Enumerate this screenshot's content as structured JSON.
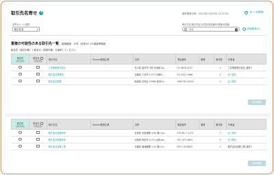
{
  "header": {
    "title": "取引先名寄せ",
    "help_icon": "help-icon",
    "updated": "最終更新日時：2021年11月30日 14:07:00",
    "update_link": "データ更新"
  },
  "filter": {
    "label": "名寄せルール選択",
    "value": "取引先名"
  },
  "search": {
    "label": "取引先名/取引先区分/住所/電話番号/業種/代表者",
    "placeholder": "検索",
    "detail_link": "詳細検索(5)"
  },
  "section": {
    "title": "重複の可能性のある取引先一覧",
    "count": "重複候補：12件（全体の0.2%重複率程度）",
    "note": "統合先（保存対象）と統合元（削除対象）を選択してください"
  },
  "table1": {
    "headers": {
      "merge_to": "統合先",
      "merge_to_sub": "(保存対象)",
      "merge_from": "統合元",
      "merge_from_sub": "(削除対象)",
      "name": "取引先名",
      "sansan": "Sansan登録企業",
      "address": "住所",
      "phone": "電話番号",
      "industry": "業種",
      "count": "案件数",
      "rep": "代表者"
    },
    "rows": [
      {
        "name": "三井物産株式会社",
        "sansan": "",
        "address": "石川県 金沢市 中町 石坂町Lw…",
        "phone": "03-3876-5272",
        "industry": "",
        "count": "1",
        "rep": "三井物産株式会社_案件1"
      },
      {
        "name": "株式会社電算商",
        "sansan": "",
        "address": "青森県 三沢市 3-277 大崎Lt…",
        "phone": "03-2337-1968",
        "industry": "",
        "count": "2",
        "rep": "全て表示"
      },
      {
        "name": "株式会社電算",
        "sansan": "",
        "address": "新潟県 中央区 25980 松本Lo…",
        "phone": "058178-3-6192",
        "industry": "",
        "count": "2",
        "rep": "全て表示"
      }
    ],
    "button": "統合確認"
  },
  "table2": {
    "rows": [
      {
        "name": "株式会社佐藤商事",
        "sansan": "",
        "address": "奈良県 北葛城郡 4-65 登川Lw…",
        "phone": "075-61-7-1175",
        "industry": "",
        "count": "3",
        "rep": "全て表示"
      },
      {
        "name": "株式会社佐藤商事",
        "sansan": "",
        "address": "大阪府 吹田市 1132 山田Lwa…",
        "phone": "057-473-4653",
        "industry": "",
        "count": "5",
        "rep": "全て表示"
      },
      {
        "name": "株式会社佐藤工業",
        "sansan": "",
        "address": "青森県 南津軽郡 3-25 登川Lc…",
        "phone": "0571-45-8652",
        "industry": "",
        "count": "1",
        "rep": "株式会社佐藤工業_案件1"
      }
    ],
    "button": "統合確認"
  },
  "colors": {
    "accent": "#1aa3a3",
    "frame": "#f08a3c",
    "button": "#bcd8dc"
  }
}
